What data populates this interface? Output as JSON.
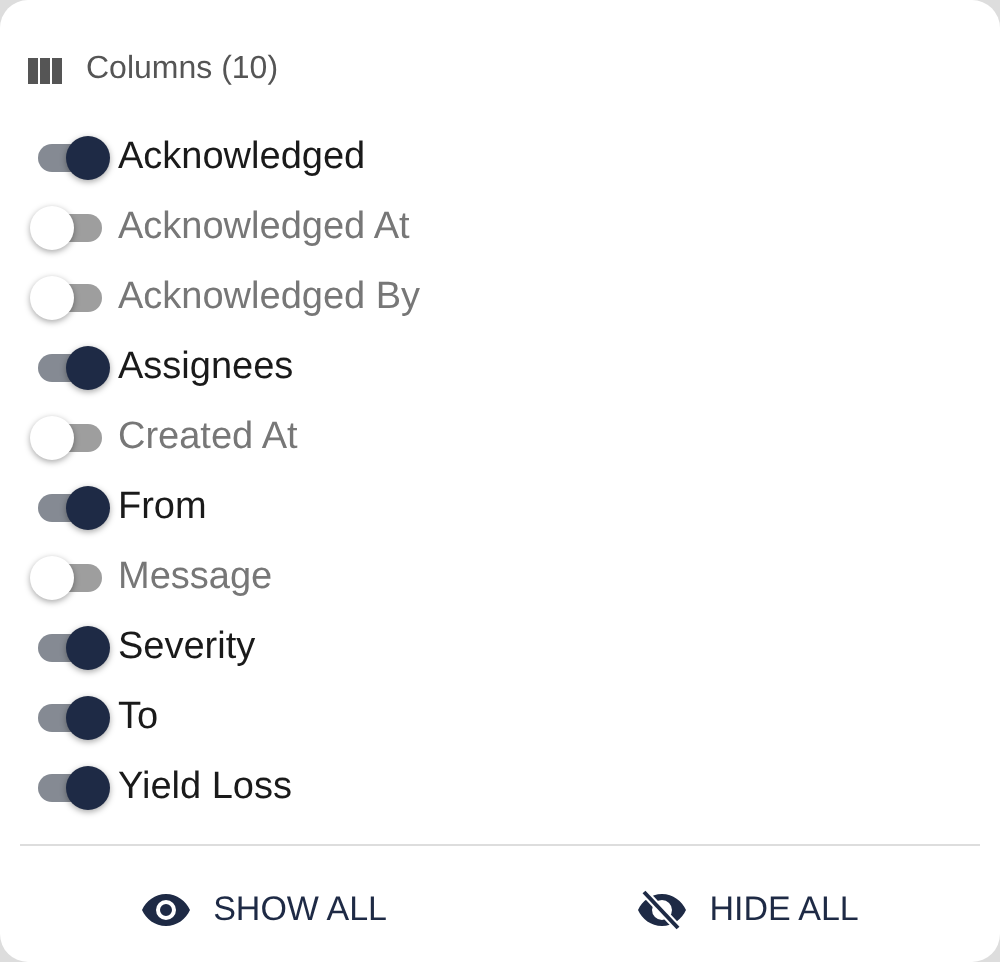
{
  "header": {
    "title": "Columns (10)"
  },
  "columns": [
    {
      "label": "Acknowledged",
      "on": true
    },
    {
      "label": "Acknowledged At",
      "on": false
    },
    {
      "label": "Acknowledged By",
      "on": false
    },
    {
      "label": "Assignees",
      "on": true
    },
    {
      "label": "Created At",
      "on": false
    },
    {
      "label": "From",
      "on": true
    },
    {
      "label": "Message",
      "on": false
    },
    {
      "label": "Severity",
      "on": true
    },
    {
      "label": "To",
      "on": true
    },
    {
      "label": "Yield Loss",
      "on": true
    }
  ],
  "actions": [
    {
      "label": "SHOW ALL",
      "kind": "show"
    },
    {
      "label": "HIDE ALL",
      "kind": "hide"
    }
  ]
}
